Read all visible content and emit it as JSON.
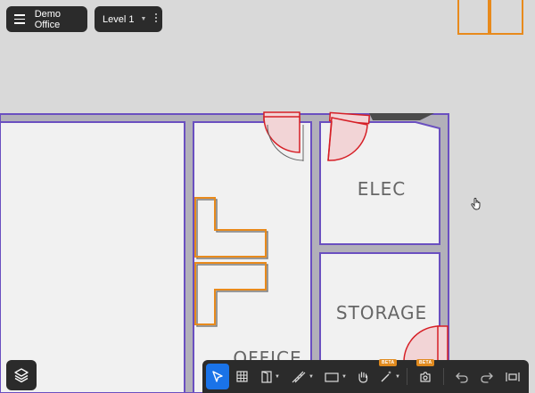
{
  "header": {
    "project_name": "Demo Office",
    "level_label": "Level 1"
  },
  "rooms": {
    "elec": "ELEC",
    "storage": "STORAGE",
    "office": "OFFICE"
  },
  "toolbar": {
    "beta_badge_labels": [
      "BETA",
      "BETA"
    ],
    "tools": [
      "select",
      "grid",
      "door",
      "stairs",
      "shape",
      "pan",
      "magic-wand",
      "camera-settings",
      "undo",
      "redo",
      "fit-view"
    ]
  },
  "colors": {
    "wall_outline": "#6a4fc0",
    "wall_fill": "#b2b0b9",
    "floor": "#f1f1f1",
    "furniture": "#e88a1c",
    "door": "#d61f26",
    "door_fill": "#f2d4d6",
    "accent": "#1a73e8",
    "panel": "#2b2b2b",
    "beta": "#e08a1e"
  }
}
